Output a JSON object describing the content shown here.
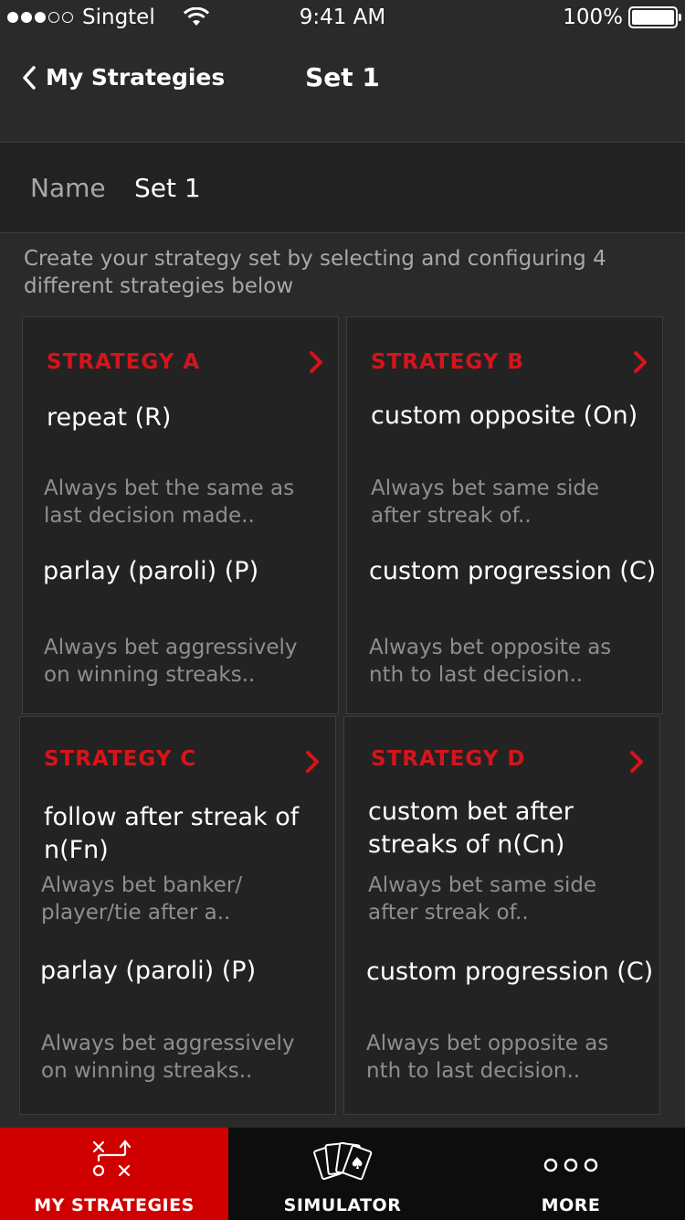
{
  "status_bar": {
    "carrier": "Singtel",
    "time": "9:41 AM",
    "battery": "100%"
  },
  "nav": {
    "back_label": "My Strategies",
    "title": "Set 1"
  },
  "name_row": {
    "label": "Name",
    "value": "Set 1"
  },
  "instructions": "Create your strategy set by selecting and configuring 4 different strategies below",
  "strategies": [
    {
      "title": "STRATEGY A",
      "primary_name": "repeat (R)",
      "primary_desc": "Always bet the same as last decision made..",
      "secondary_name": "parlay (paroli) (P)",
      "secondary_desc": "Always bet aggressively on winning streaks.."
    },
    {
      "title": "STRATEGY B",
      "primary_name": "custom opposite (On)",
      "primary_desc": "Always bet same side after streak of..",
      "secondary_name": "custom progression (C)",
      "secondary_desc": "Always bet opposite as nth to last decision.."
    },
    {
      "title": "STRATEGY C",
      "primary_name": "follow after streak of n(Fn)",
      "primary_desc": "Always bet banker/ player/tie after a..",
      "secondary_name": "parlay (paroli) (P)",
      "secondary_desc": "Always bet aggressively on winning streaks.."
    },
    {
      "title": "STRATEGY D",
      "primary_name": "custom bet after streaks of n(Cn)",
      "primary_desc": "Always bet same side after streak of..",
      "secondary_name": "custom progression (C)",
      "secondary_desc": "Always bet opposite as nth to last decision.."
    }
  ],
  "tabs": [
    {
      "label": "MY STRATEGIES",
      "icon": "strategy-play-icon",
      "active": true
    },
    {
      "label": "SIMULATOR",
      "icon": "cards-icon",
      "active": false
    },
    {
      "label": "MORE",
      "icon": "more-dots-icon",
      "active": false
    }
  ],
  "colors": {
    "accent": "#d00000",
    "strategy_title": "#d6141a",
    "background": "#2a2a2a",
    "card": "#232323",
    "muted_text": "#8e8e8e"
  }
}
